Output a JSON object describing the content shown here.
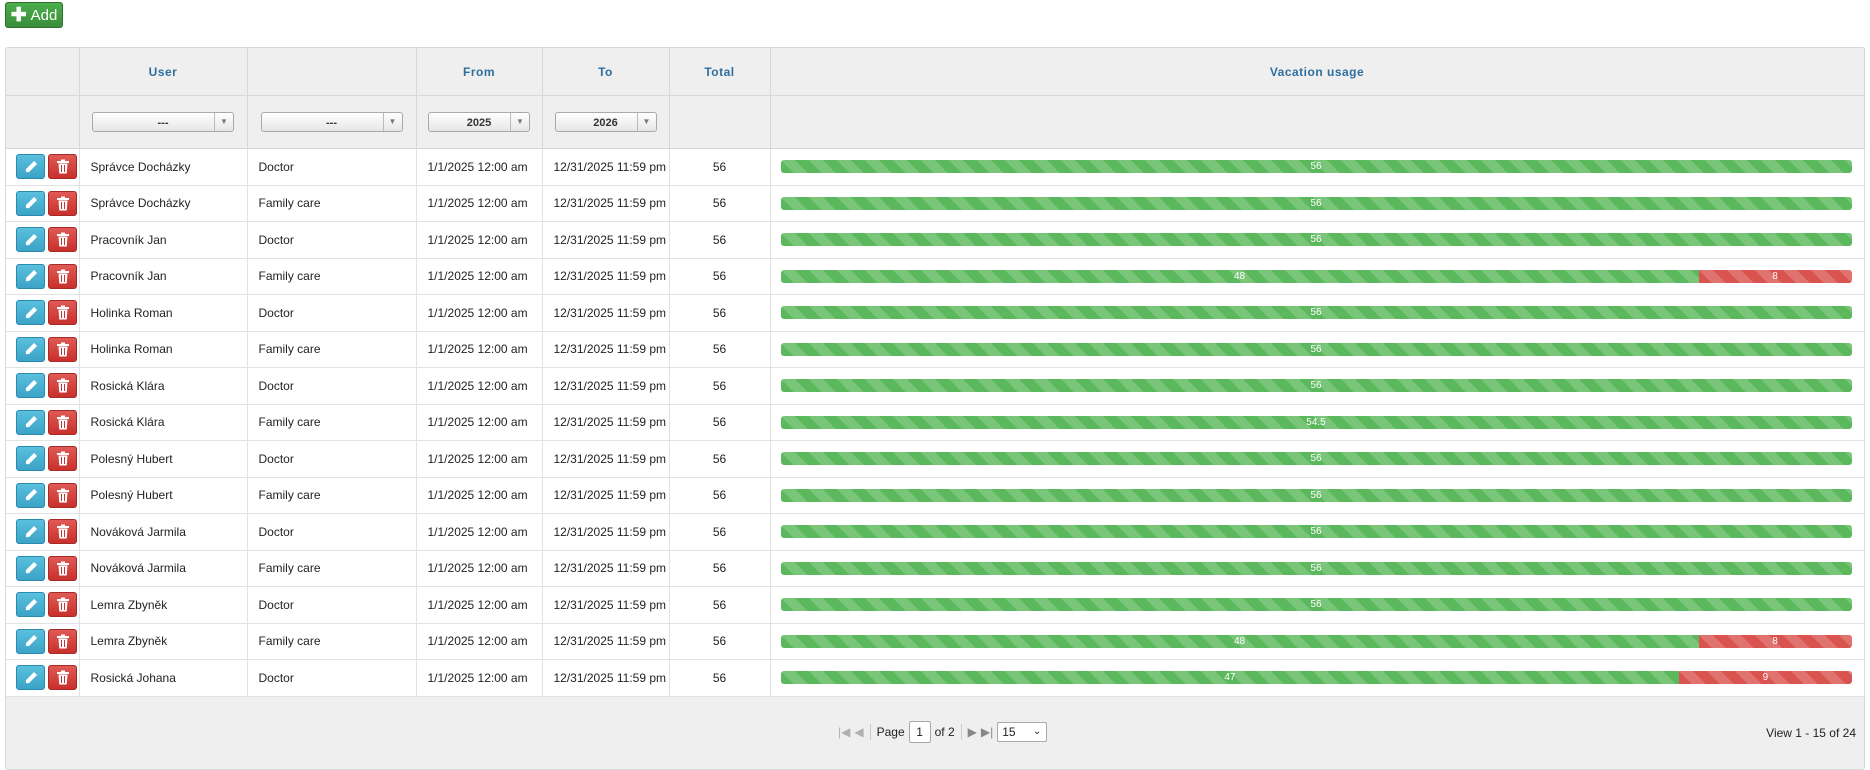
{
  "toolbar": {
    "add_label": "Add"
  },
  "columns": {
    "actions": "",
    "user": "User",
    "type": "",
    "from": "From",
    "to": "To",
    "total": "Total",
    "usage": "Vacation usage"
  },
  "filters": {
    "user": "---",
    "type": "---",
    "from": "2025",
    "to": "2026"
  },
  "rows": [
    {
      "user": "Správce Docházky",
      "type": "Doctor",
      "from": "1/1/2025 12:00 am",
      "to": "12/31/2025 11:59 pm",
      "total": "56",
      "remaining": "56",
      "used": ""
    },
    {
      "user": "Správce Docházky",
      "type": "Family care",
      "from": "1/1/2025 12:00 am",
      "to": "12/31/2025 11:59 pm",
      "total": "56",
      "remaining": "56",
      "used": ""
    },
    {
      "user": "Pracovník Jan",
      "type": "Doctor",
      "from": "1/1/2025 12:00 am",
      "to": "12/31/2025 11:59 pm",
      "total": "56",
      "remaining": "56",
      "used": ""
    },
    {
      "user": "Pracovník Jan",
      "type": "Family care",
      "from": "1/1/2025 12:00 am",
      "to": "12/31/2025 11:59 pm",
      "total": "56",
      "remaining": "48",
      "used": "8"
    },
    {
      "user": "Holinka Roman",
      "type": "Doctor",
      "from": "1/1/2025 12:00 am",
      "to": "12/31/2025 11:59 pm",
      "total": "56",
      "remaining": "56",
      "used": ""
    },
    {
      "user": "Holinka Roman",
      "type": "Family care",
      "from": "1/1/2025 12:00 am",
      "to": "12/31/2025 11:59 pm",
      "total": "56",
      "remaining": "56",
      "used": ""
    },
    {
      "user": "Rosická Klára",
      "type": "Doctor",
      "from": "1/1/2025 12:00 am",
      "to": "12/31/2025 11:59 pm",
      "total": "56",
      "remaining": "56",
      "used": ""
    },
    {
      "user": "Rosická Klára",
      "type": "Family care",
      "from": "1/1/2025 12:00 am",
      "to": "12/31/2025 11:59 pm",
      "total": "56",
      "remaining": "54.5",
      "used": ""
    },
    {
      "user": "Polesný Hubert",
      "type": "Doctor",
      "from": "1/1/2025 12:00 am",
      "to": "12/31/2025 11:59 pm",
      "total": "56",
      "remaining": "56",
      "used": ""
    },
    {
      "user": "Polesný Hubert",
      "type": "Family care",
      "from": "1/1/2025 12:00 am",
      "to": "12/31/2025 11:59 pm",
      "total": "56",
      "remaining": "56",
      "used": ""
    },
    {
      "user": "Nováková Jarmila",
      "type": "Doctor",
      "from": "1/1/2025 12:00 am",
      "to": "12/31/2025 11:59 pm",
      "total": "56",
      "remaining": "56",
      "used": ""
    },
    {
      "user": "Nováková Jarmila",
      "type": "Family care",
      "from": "1/1/2025 12:00 am",
      "to": "12/31/2025 11:59 pm",
      "total": "56",
      "remaining": "56",
      "used": ""
    },
    {
      "user": "Lemra Zbyněk",
      "type": "Doctor",
      "from": "1/1/2025 12:00 am",
      "to": "12/31/2025 11:59 pm",
      "total": "56",
      "remaining": "56",
      "used": ""
    },
    {
      "user": "Lemra Zbyněk",
      "type": "Family care",
      "from": "1/1/2025 12:00 am",
      "to": "12/31/2025 11:59 pm",
      "total": "56",
      "remaining": "48",
      "used": "8"
    },
    {
      "user": "Rosická Johana",
      "type": "Doctor",
      "from": "1/1/2025 12:00 am",
      "to": "12/31/2025 11:59 pm",
      "total": "56",
      "remaining": "47",
      "used": "9"
    }
  ],
  "pager": {
    "page_label": "Page",
    "page_value": "1",
    "of_label": "of 2",
    "rows_per_page": "15",
    "view_label": "View 1 - 15 of 24"
  },
  "colors": {
    "add_green": "#4cae4c",
    "header_blue": "#2e6e9e",
    "edit_blue": "#5bc0de",
    "delete_red": "#d9534f",
    "bar_green": "#5cb85c",
    "bar_red": "#d9534f"
  },
  "icons": {
    "add": "plus-icon",
    "edit": "pencil-icon",
    "delete": "trash-icon"
  }
}
